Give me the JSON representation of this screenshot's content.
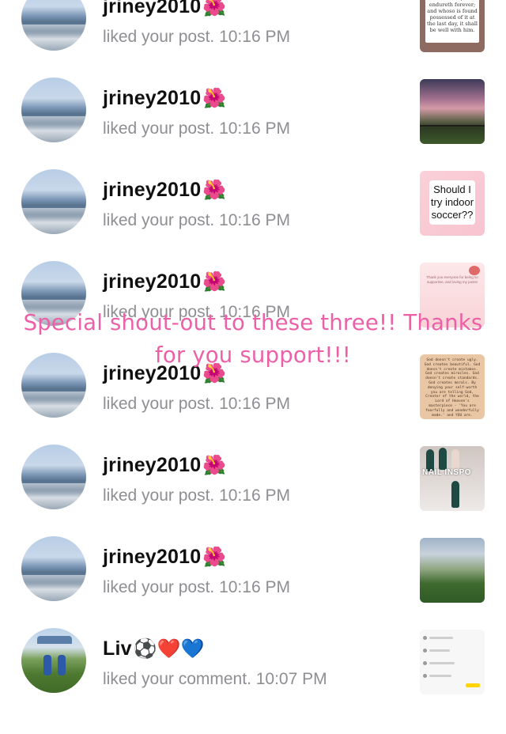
{
  "rows": [
    {
      "name": "jriney2010",
      "emoji": "🌺",
      "action": "liked your post. 10:16 PM",
      "thumb_text": "Charity is the pure love of Christ, and it endureth forever; and whoso is found possessed of it at the last day, it shall be well with him."
    },
    {
      "name": "jriney2010",
      "emoji": "🌺",
      "action": "liked your post. 10:16 PM"
    },
    {
      "name": "jriney2010",
      "emoji": "🌺",
      "action": "liked your post. 10:16 PM",
      "thumb_text": "Should I try indoor soccer??"
    },
    {
      "name": "jriney2010",
      "emoji": "🌺",
      "action": "liked your post. 10:16 PM",
      "thumb_text": "Thank you everyone for being so supportive, and loving my posts!"
    },
    {
      "name": "jriney2010",
      "emoji": "🌺",
      "action": "liked your post. 10:16 PM",
      "thumb_text": "God doesn't create ugly. God creates beautiful. God doesn't create mistakes. God creates miracles. God doesn't create standards. God creates morals. By denying your self-worth you are telling God, Creator of the world, the Lord of Heaven's masterpiece - 'You are fearfully and wonderfully made.' and YOU are."
    },
    {
      "name": "jriney2010",
      "emoji": "🌺",
      "action": "liked your post. 10:16 PM",
      "thumb_text": "NAIL INSPO"
    },
    {
      "name": "jriney2010",
      "emoji": "🌺",
      "action": "liked your post. 10:16 PM"
    },
    {
      "name": "Liv",
      "emoji": "⚽❤️💙",
      "action": "liked your comment. 10:07 PM"
    }
  ],
  "overlay": {
    "line1": "Special shout-out to these three!! Thanks",
    "line2": "for you support!!!"
  }
}
